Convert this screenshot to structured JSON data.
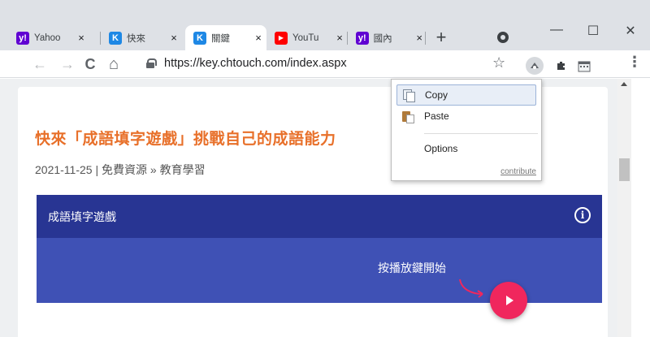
{
  "browser": {
    "tabs": [
      {
        "favicon": "yahoo-icon",
        "favicon_color": "#6001d2",
        "favicon_glyph": "y!",
        "title": "Yahoo",
        "close": "×",
        "active": false
      },
      {
        "favicon": "chtouch-icon",
        "favicon_color": "#1e88e5",
        "favicon_glyph": "K",
        "title": "快來",
        "close": "×",
        "active": false
      },
      {
        "favicon": "chtouch-icon",
        "favicon_color": "#1e88e5",
        "favicon_glyph": "K",
        "title": "關鍵",
        "close": "×",
        "active": true
      },
      {
        "favicon": "youtube-icon",
        "favicon_color": "#ff0000",
        "favicon_glyph": "▶",
        "title": "YouTu",
        "close": "×",
        "active": false
      },
      {
        "favicon": "yahoo-icon",
        "favicon_color": "#6001d2",
        "favicon_glyph": "y!",
        "title": "國內",
        "close": "×",
        "active": false
      }
    ],
    "new_tab_label": "+",
    "window_controls": {
      "minimize": "—",
      "maximize": "☐",
      "close": "✕"
    },
    "nav": {
      "back": "←",
      "forward": "→",
      "reload": "C",
      "home": "⌂"
    },
    "url": "https://key.chtouch.com/index.aspx",
    "bookmark_star": "☆",
    "menu_dots": "⋮"
  },
  "page": {
    "article_title": "快來「成語填字遊戲」挑戰自己的成語能力",
    "date": "2021-11-25",
    "separator": " | ",
    "category": "免費資源 » 教育學習",
    "game": {
      "title": "成語填字遊戲",
      "info_glyph": "i",
      "hint": "按播放鍵開始"
    }
  },
  "context_menu": {
    "copy_label": "Copy",
    "paste_label": "Paste",
    "options_label": "Options",
    "contribute_label": "contribute"
  },
  "colors": {
    "accent_orange": "#e8702a",
    "header_indigo": "#283593",
    "band_indigo": "#3f51b5",
    "play_pink": "#f0275d"
  }
}
